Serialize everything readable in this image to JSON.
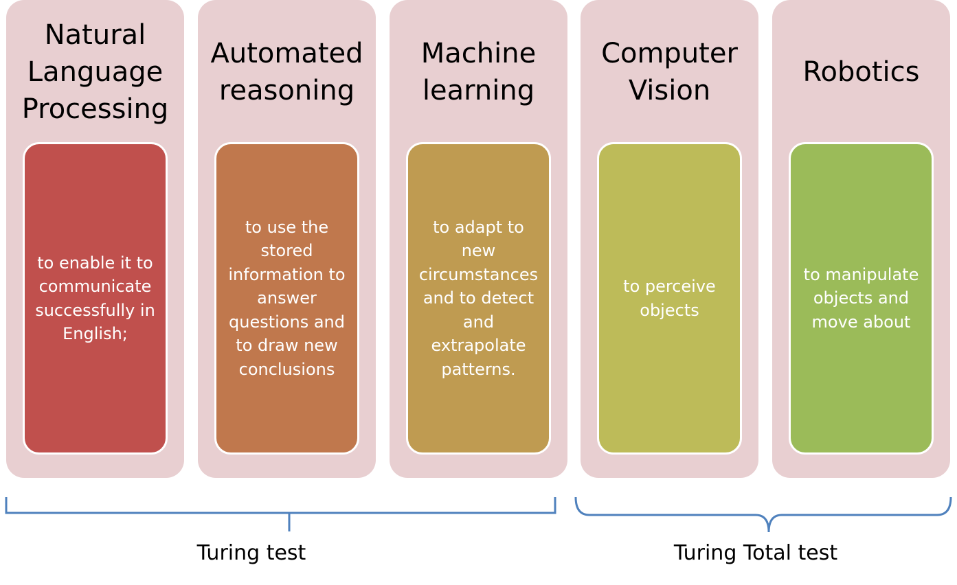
{
  "columns": [
    {
      "title": "Natural Language Processing",
      "description": "to enable it to communicate successfully in English;",
      "card_color": "#c0504d"
    },
    {
      "title": "Automated reasoning",
      "description": "to use the stored information to answer questions and to draw new conclusions",
      "card_color": "#c0784d"
    },
    {
      "title": "Machine learning",
      "description": "to adapt to new circumstances and to detect and extrapolate patterns.",
      "card_color": "#bf9b51"
    },
    {
      "title": "Computer Vision",
      "description": "to perceive objects",
      "card_color": "#bdbb59"
    },
    {
      "title": "Robotics",
      "description": "to manipulate objects and move about",
      "card_color": "#9bbb59"
    }
  ],
  "groups": [
    {
      "label": "Turing test"
    },
    {
      "label": "Turing Total test"
    }
  ],
  "colors": {
    "column_background": "#e8cfd1",
    "bracket": "#4f81bd"
  }
}
